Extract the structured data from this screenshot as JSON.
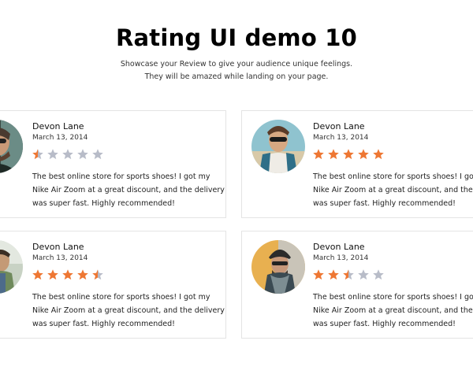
{
  "page": {
    "title": "Rating UI demo 10",
    "subtitle": "Showcase your Review to give your audience unique feelings. They will be amazed while landing on your page."
  },
  "colors": {
    "star_filled": "#ee7733",
    "star_empty": "#b8bcc8",
    "card_border": "#e4e4e4"
  },
  "reviews": [
    {
      "name": "Devon Lane",
      "date": "March 13, 2014",
      "rating": 0.5,
      "max_rating": 5,
      "text": "The best online store for sports shoes! I got my Nike Air Zoom at a great discount, and the delivery was super fast. Highly recommended!"
    },
    {
      "name": "Devon Lane",
      "date": "March 13, 2014",
      "rating": 5,
      "max_rating": 5,
      "text": "The best online store for sports shoes! I got my Nike Air Zoom at a great discount, and the delivery was super fast. Highly recommended!"
    },
    {
      "name": "Devon Lane",
      "date": "March 13, 2014",
      "rating": 4.5,
      "max_rating": 5,
      "text": "The best online store for sports shoes! I got my Nike Air Zoom at a great discount, and the delivery was super fast. Highly recommended!"
    },
    {
      "name": "Devon Lane",
      "date": "March 13, 2014",
      "rating": 2.5,
      "max_rating": 5,
      "text": "The best online store for sports shoes! I got my Nike Air Zoom at a great discount, and the delivery was super fast. Highly recommended!"
    }
  ]
}
